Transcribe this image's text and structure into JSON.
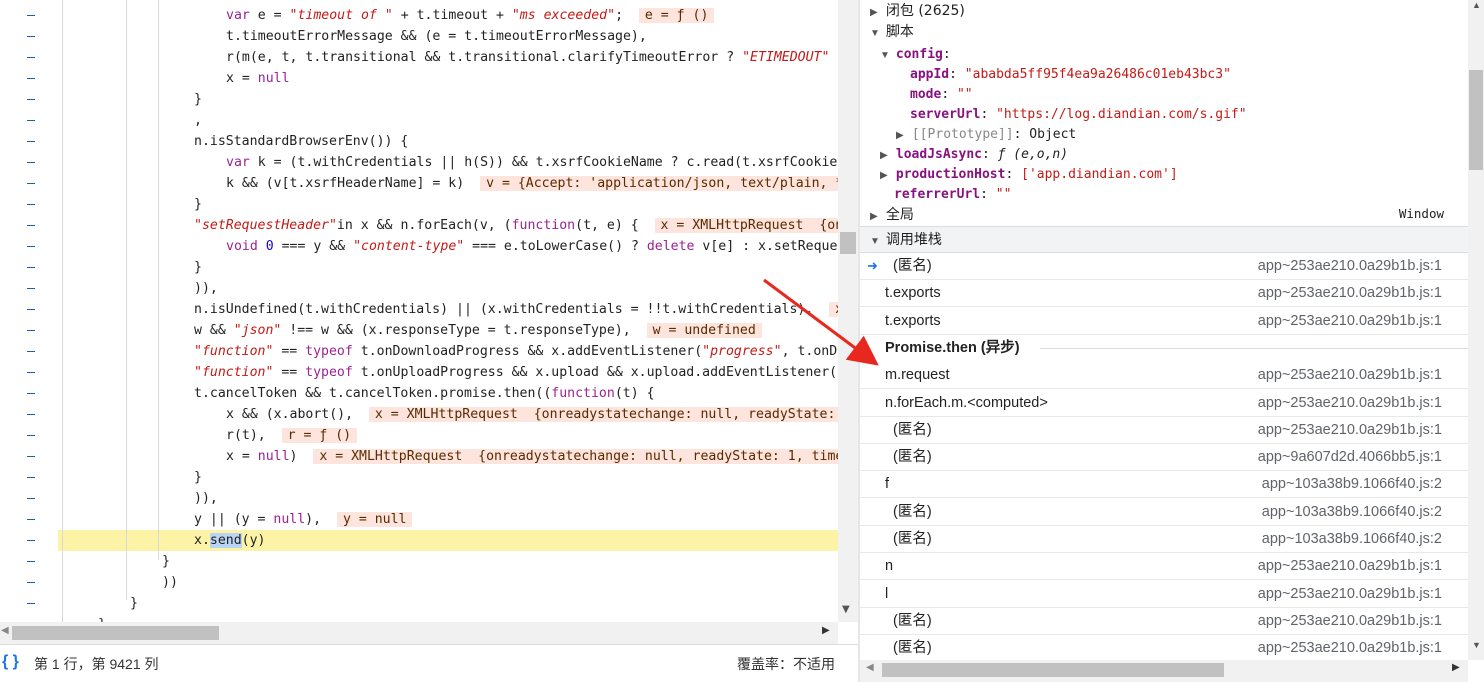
{
  "code": {
    "lines": [
      {
        "indent": 226,
        "html_parts": [
          {
            "t": "var ",
            "c": "kw"
          },
          {
            "t": "e = "
          },
          {
            "t": "\"timeout of \"",
            "c": "str"
          },
          {
            "t": " + t.timeout + "
          },
          {
            "t": "\"ms exceeded\"",
            "c": "str"
          },
          {
            "t": ";  "
          },
          {
            "t": "e = ƒ ()",
            "c": "inline-val"
          }
        ]
      },
      {
        "indent": 226,
        "html_parts": [
          {
            "t": "t.timeoutErrorMessage && (e = t.timeoutErrorMessage),"
          }
        ]
      },
      {
        "indent": 226,
        "html_parts": [
          {
            "t": "r(m(e, t, t.transitional && t.transitional.clarifyTimeoutError ? "
          },
          {
            "t": "\"ETIMEDOUT\"",
            "c": "str"
          }
        ]
      },
      {
        "indent": 226,
        "html_parts": [
          {
            "t": "x = "
          },
          {
            "t": "null",
            "c": "kw"
          }
        ]
      },
      {
        "indent": 194,
        "html_parts": [
          {
            "t": "}"
          }
        ]
      },
      {
        "indent": 194,
        "html_parts": [
          {
            "t": ","
          }
        ]
      },
      {
        "indent": 194,
        "html_parts": [
          {
            "t": "n.isStandardBrowserEnv()) {"
          }
        ]
      },
      {
        "indent": 226,
        "html_parts": [
          {
            "t": "var ",
            "c": "kw"
          },
          {
            "t": "k = (t.withCredentials || h(S)) && t.xsrfCookieName ? c.read(t.xsrfCookie"
          }
        ]
      },
      {
        "indent": 226,
        "html_parts": [
          {
            "t": "k && (v[t.xsrfHeaderName] = k)  "
          },
          {
            "t": "v = {Accept: 'application/json, text/plain, *",
            "c": "inline-val"
          }
        ]
      },
      {
        "indent": 194,
        "html_parts": [
          {
            "t": "}"
          }
        ]
      },
      {
        "indent": 194,
        "html_parts": [
          {
            "t": "\"setRequestHeader\"",
            "c": "str"
          },
          {
            "t": "in x && n.forEach(v, ("
          },
          {
            "t": "function",
            "c": "kw"
          },
          {
            "t": "(t, e) {  "
          },
          {
            "t": "x = XMLHttpRequest  {on",
            "c": "inline-val"
          }
        ]
      },
      {
        "indent": 226,
        "html_parts": [
          {
            "t": "void ",
            "c": "kw"
          },
          {
            "t": "0",
            "c": "num"
          },
          {
            "t": " === y && "
          },
          {
            "t": "\"content-type\"",
            "c": "str"
          },
          {
            "t": " === e.toLowerCase() ? "
          },
          {
            "t": "delete ",
            "c": "kw"
          },
          {
            "t": "v[e] : x.setReque"
          }
        ]
      },
      {
        "indent": 194,
        "html_parts": [
          {
            "t": "}"
          }
        ]
      },
      {
        "indent": 194,
        "html_parts": [
          {
            "t": ")),"
          }
        ]
      },
      {
        "indent": 194,
        "html_parts": [
          {
            "t": "n.isUndefined(t.withCredentials) || (x.withCredentials = !!t.withCredentials),  "
          },
          {
            "t": "x",
            "c": "inline-val"
          }
        ]
      },
      {
        "indent": 194,
        "html_parts": [
          {
            "t": "w && "
          },
          {
            "t": "\"json\"",
            "c": "str"
          },
          {
            "t": " !== w && (x.responseType = t.responseType),  "
          },
          {
            "t": "w = undefined",
            "c": "inline-val"
          }
        ]
      },
      {
        "indent": 194,
        "html_parts": [
          {
            "t": "\"function\"",
            "c": "str"
          },
          {
            "t": " == "
          },
          {
            "t": "typeof ",
            "c": "kw"
          },
          {
            "t": "t.onDownloadProgress && x.addEventListener("
          },
          {
            "t": "\"progress\"",
            "c": "str"
          },
          {
            "t": ", t.onD"
          }
        ]
      },
      {
        "indent": 194,
        "html_parts": [
          {
            "t": "\"function\"",
            "c": "str"
          },
          {
            "t": " == "
          },
          {
            "t": "typeof ",
            "c": "kw"
          },
          {
            "t": "t.onUploadProgress && x.upload && x.upload.addEventListener("
          }
        ]
      },
      {
        "indent": 194,
        "html_parts": [
          {
            "t": "t.cancelToken && t.cancelToken.promise.then(("
          },
          {
            "t": "function",
            "c": "kw"
          },
          {
            "t": "(t) {"
          }
        ]
      },
      {
        "indent": 226,
        "html_parts": [
          {
            "t": "x && (x.abort(),  "
          },
          {
            "t": "x = XMLHttpRequest  {onreadystatechange: null, readyState:",
            "c": "inline-val"
          }
        ]
      },
      {
        "indent": 226,
        "html_parts": [
          {
            "t": "r(t),  "
          },
          {
            "t": "r = ƒ ()",
            "c": "inline-val"
          }
        ]
      },
      {
        "indent": 226,
        "html_parts": [
          {
            "t": "x = "
          },
          {
            "t": "null",
            "c": "kw"
          },
          {
            "t": ")  "
          },
          {
            "t": "x = XMLHttpRequest  {onreadystatechange: null, readyState: 1, time",
            "c": "inline-val"
          }
        ]
      },
      {
        "indent": 194,
        "html_parts": [
          {
            "t": "}"
          }
        ]
      },
      {
        "indent": 194,
        "html_parts": [
          {
            "t": ")),"
          }
        ]
      },
      {
        "indent": 194,
        "html_parts": [
          {
            "t": "y || (y = "
          },
          {
            "t": "null",
            "c": "kw"
          },
          {
            "t": "),  "
          },
          {
            "t": "y = null",
            "c": "inline-val"
          }
        ]
      },
      {
        "indent": 194,
        "highlight": true,
        "html_parts": [
          {
            "t": "x."
          },
          {
            "t": "send",
            "c": "sel-word"
          },
          {
            "t": "(y)"
          }
        ]
      },
      {
        "indent": 162,
        "html_parts": [
          {
            "t": "}"
          }
        ]
      },
      {
        "indent": 162,
        "html_parts": [
          {
            "t": "))"
          }
        ]
      },
      {
        "indent": 130,
        "html_parts": [
          {
            "t": "}"
          }
        ]
      },
      {
        "indent": 98,
        "html_parts": [
          {
            "t": "}"
          }
        ]
      }
    ]
  },
  "status_bar": {
    "braces": "{ }",
    "position": "第 1 行，第 9421 列",
    "coverage": "覆盖率：不适用"
  },
  "scope": {
    "closure_label": "闭包 (2625)",
    "script_label": "脚本",
    "config_label": "config",
    "appId_key": "appId",
    "appId_value": "\"ababda5ff95f4ea9a26486c01eb43bc3\"",
    "mode_key": "mode",
    "mode_value": "\"\"",
    "serverUrl_key": "serverUrl",
    "serverUrl_value": "\"https://log.diandian.com/s.gif\"",
    "prototype_key": "[[Prototype]]",
    "prototype_value": "Object",
    "loadJsAsync_key": "loadJsAsync",
    "loadJsAsync_value": "ƒ (e,o,n)",
    "productionHost_key": "productionHost",
    "productionHost_value": "['app.diandian.com']",
    "referrerUrl_key": "referrerUrl",
    "referrerUrl_value": "\"\"",
    "global_label": "全局",
    "global_value": "Window"
  },
  "call_stack": {
    "header": "调用堆栈",
    "frames": [
      {
        "name": "(匿名)",
        "loc": "app~253ae210.0a29b1b.js:1",
        "current": true,
        "indent": true
      },
      {
        "name": "t.exports",
        "loc": "app~253ae210.0a29b1b.js:1"
      },
      {
        "name": "t.exports",
        "loc": "app~253ae210.0a29b1b.js:1"
      },
      {
        "async": true,
        "name": "Promise.then (异步)"
      },
      {
        "name": "m.request",
        "loc": "app~253ae210.0a29b1b.js:1"
      },
      {
        "name": "n.forEach.m.<computed>",
        "loc": "app~253ae210.0a29b1b.js:1"
      },
      {
        "name": "(匿名)",
        "loc": "app~253ae210.0a29b1b.js:1",
        "indent": true
      },
      {
        "name": "(匿名)",
        "loc": "app~9a607d2d.4066bb5.js:1",
        "indent": true
      },
      {
        "name": "f",
        "loc": "app~103a38b9.1066f40.js:2"
      },
      {
        "name": "(匿名)",
        "loc": "app~103a38b9.1066f40.js:2",
        "indent": true
      },
      {
        "name": "(匿名)",
        "loc": "app~103a38b9.1066f40.js:2",
        "indent": true
      },
      {
        "name": "n",
        "loc": "app~253ae210.0a29b1b.js:1"
      },
      {
        "name": "l",
        "loc": "app~253ae210.0a29b1b.js:1"
      },
      {
        "name": "(匿名)",
        "loc": "app~253ae210.0a29b1b.js:1",
        "indent": true
      },
      {
        "name": "(匿名)",
        "loc": "app~253ae210.0a29b1b.js:1",
        "indent": true
      }
    ]
  },
  "icons": {
    "expand": "▶",
    "collapse": "▼",
    "current_frame": "arrow-right-icon",
    "scroll_up": "▲",
    "scroll_down": "▼",
    "scroll_left": "◀",
    "scroll_right": "▶"
  },
  "colors": {
    "annotation_arrow": "#e8281e",
    "highlight_line": "#fcf3a6",
    "inline_value_bg": "#fde4dc",
    "current_frame_icon": "#1a73e8"
  }
}
